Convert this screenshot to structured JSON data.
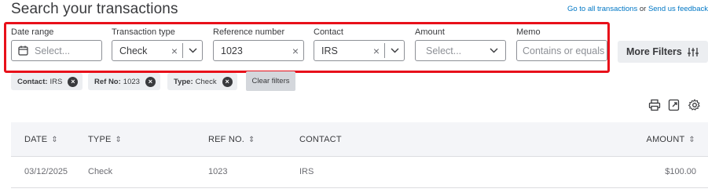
{
  "page": {
    "title": "Search your transactions",
    "link_all_transactions": "Go to all transactions",
    "link_or": " or ",
    "link_feedback": "Send us feedback"
  },
  "filters": {
    "date_range": {
      "label": "Date range",
      "placeholder": "Select..."
    },
    "transaction_type": {
      "label": "Transaction type",
      "value": "Check"
    },
    "reference_number": {
      "label": "Reference number",
      "value": "1023"
    },
    "contact": {
      "label": "Contact",
      "value": "IRS"
    },
    "amount": {
      "label": "Amount",
      "placeholder": "Select..."
    },
    "memo": {
      "label": "Memo",
      "placeholder": "Contains or equals"
    },
    "more_filters": "More Filters",
    "highlight_color": "#e8101a"
  },
  "chips": [
    {
      "key": "Contact:",
      "value": "IRS"
    },
    {
      "key": "Ref No:",
      "value": "1023"
    },
    {
      "key": "Type:",
      "value": "Check"
    }
  ],
  "clear_filters": "Clear filters",
  "toolbar_icons": [
    "print-icon",
    "export-icon",
    "settings-gear-icon"
  ],
  "table": {
    "headers": {
      "date": "DATE",
      "type": "TYPE",
      "ref_no": "REF NO.",
      "contact": "CONTACT",
      "amount": "AMOUNT"
    },
    "rows": [
      {
        "date": "03/12/2025",
        "type": "Check",
        "ref_no": "1023",
        "contact": "IRS",
        "amount": "$100.00"
      }
    ]
  }
}
